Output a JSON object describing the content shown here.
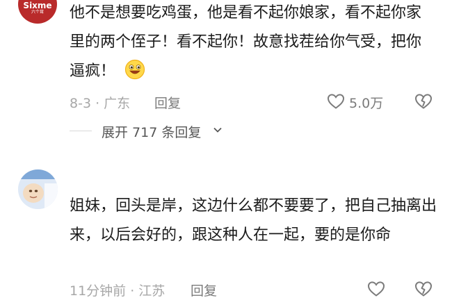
{
  "comments": [
    {
      "avatar_brand": "Sixme",
      "avatar_brand_sub": "六个茸",
      "text": "他不是想要吃鸡蛋，他是看不起你娘家，看不起你家里的两个侄子！看不起你！故意找茬给你气受，把你逼疯！",
      "emoji": "grinning-face-emoji",
      "meta": "8-3 · 广东",
      "reply_label": "回复",
      "like_count": "5.0万",
      "expand_label": "展开 717 条回复"
    },
    {
      "text": "姐妹，回头是岸，这边什么都不要要了，把自己抽离出来，以后会好的，跟这种人在一起，要的是你命",
      "meta": "11分钟前 · 江苏",
      "reply_label": "回复"
    }
  ],
  "colors": {
    "text": "#1b1b1b",
    "meta": "#a7a7a7",
    "icon": "#7b7b7b"
  }
}
